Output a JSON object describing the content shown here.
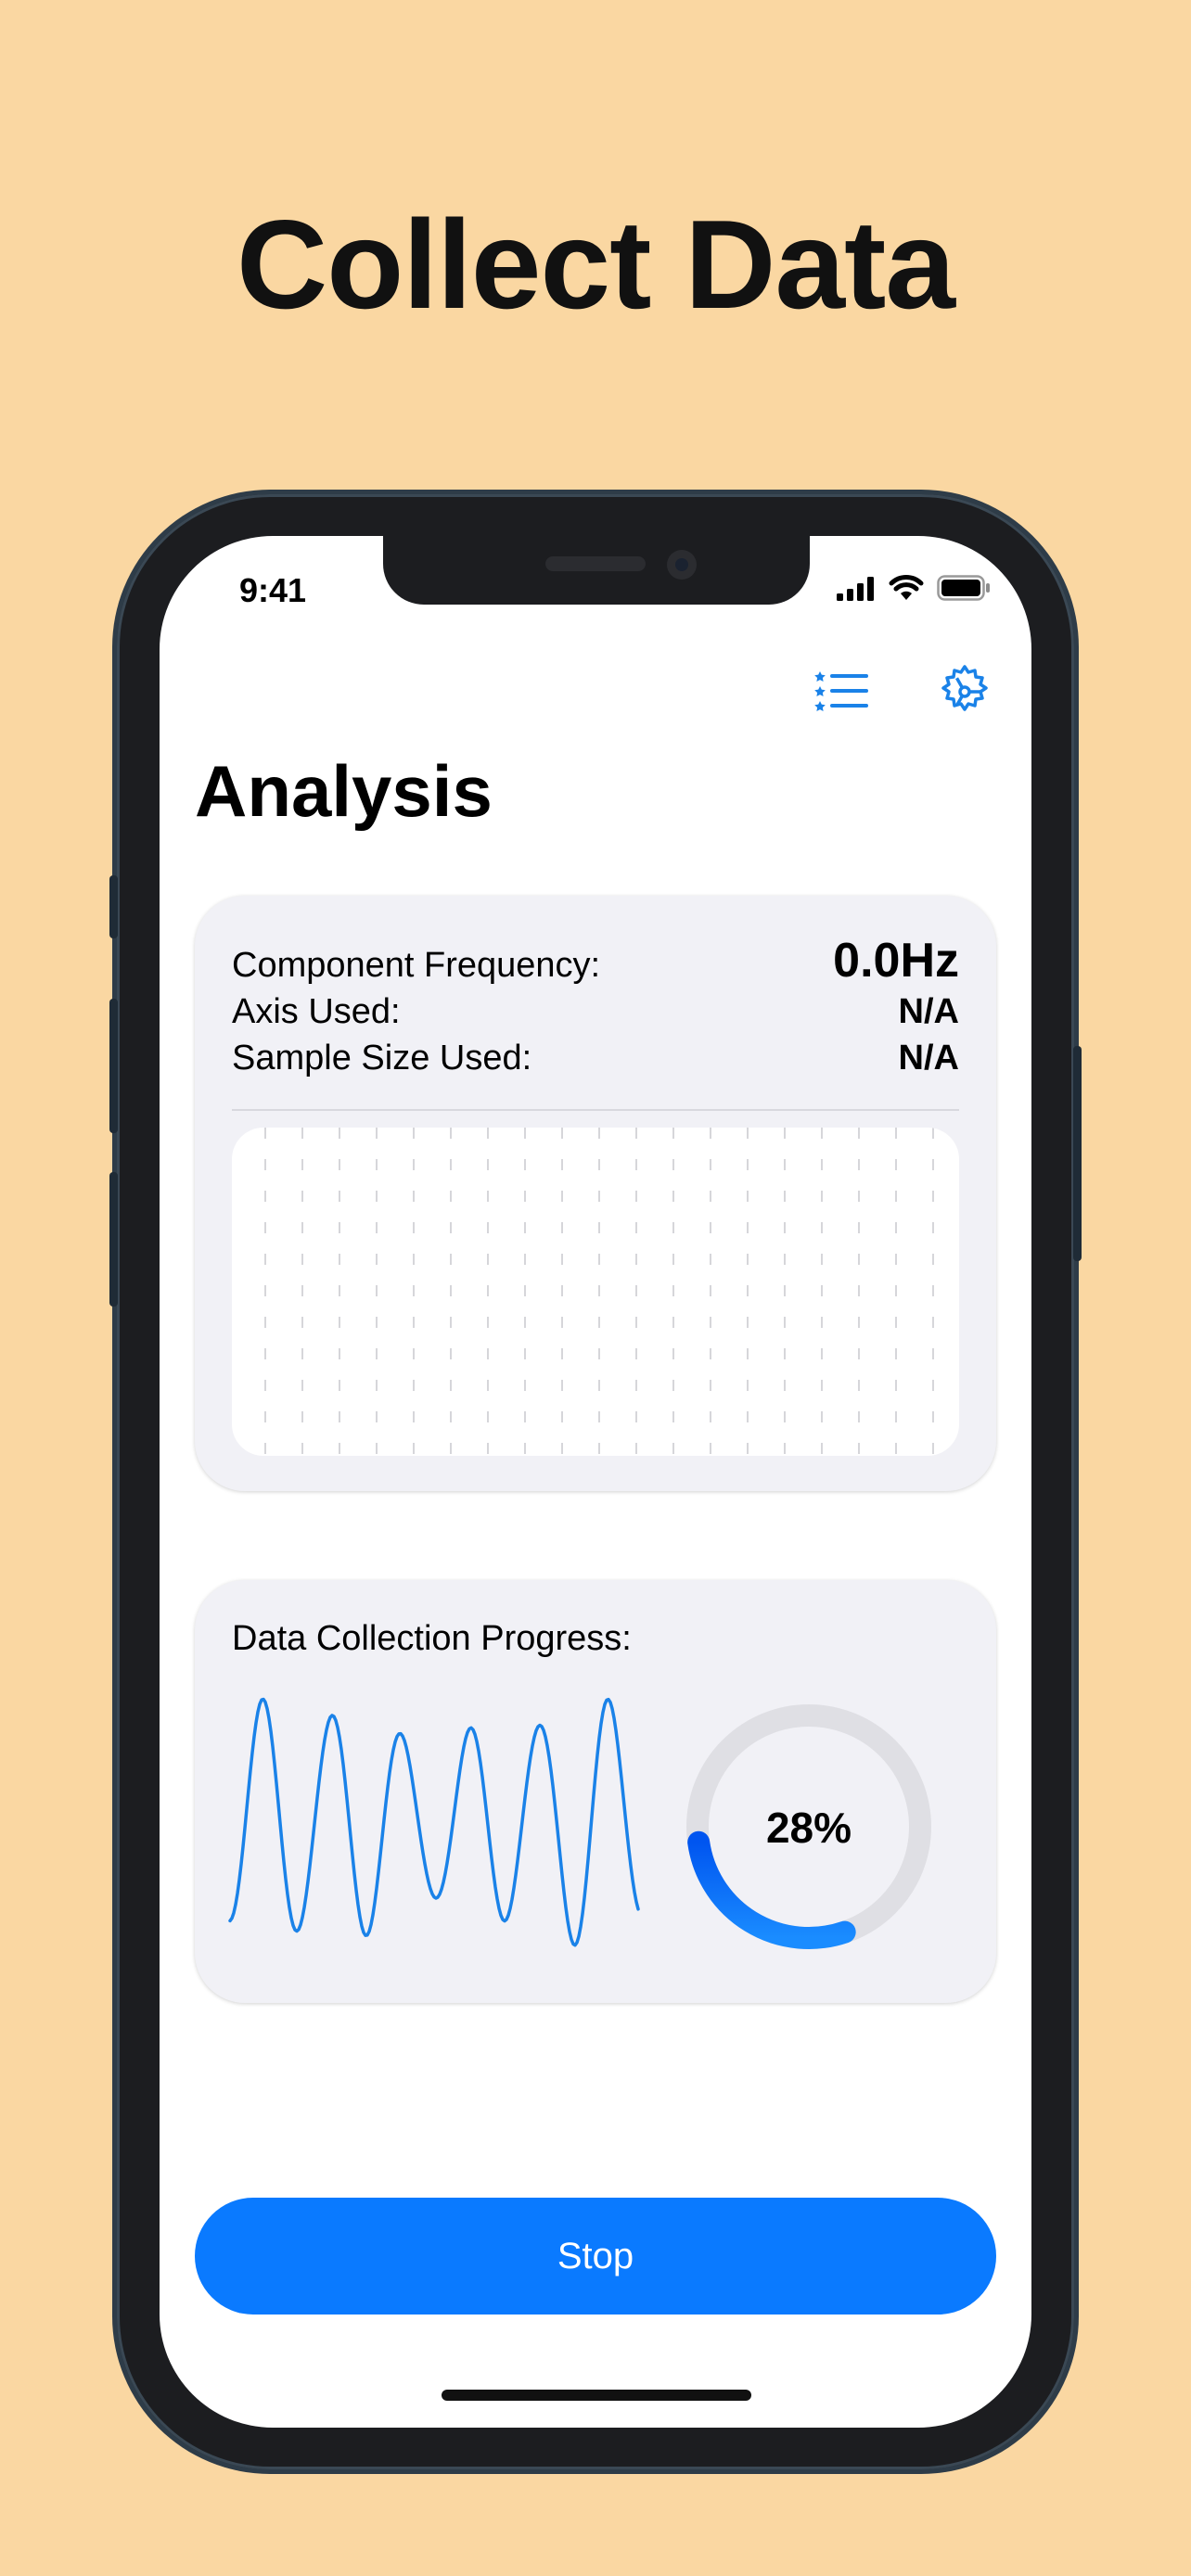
{
  "headline": "Collect Data",
  "status_bar": {
    "time": "9:41"
  },
  "page": {
    "title": "Analysis"
  },
  "analysis_card": {
    "frequency_label": "Component Frequency:",
    "frequency_value": "0.0Hz",
    "axis_label": "Axis Used:",
    "axis_value": "N/A",
    "sample_label": "Sample Size Used:",
    "sample_value": "N/A",
    "plot_colors": {
      "start": "#F39A2B",
      "end": "#E8459A"
    }
  },
  "progress_card": {
    "label": "Data Collection Progress:",
    "percent_text": "28%",
    "progress": 0.28,
    "waveform_color": "#1A82E8",
    "ring_track_color": "#DFDFE4",
    "ring_colors": {
      "start": "#0055F0",
      "end": "#1A8CFF"
    }
  },
  "stop_button": {
    "label": "Stop",
    "color": "#0A7AFF"
  },
  "icons": {
    "list": "list-icon",
    "settings": "gear-icon"
  }
}
